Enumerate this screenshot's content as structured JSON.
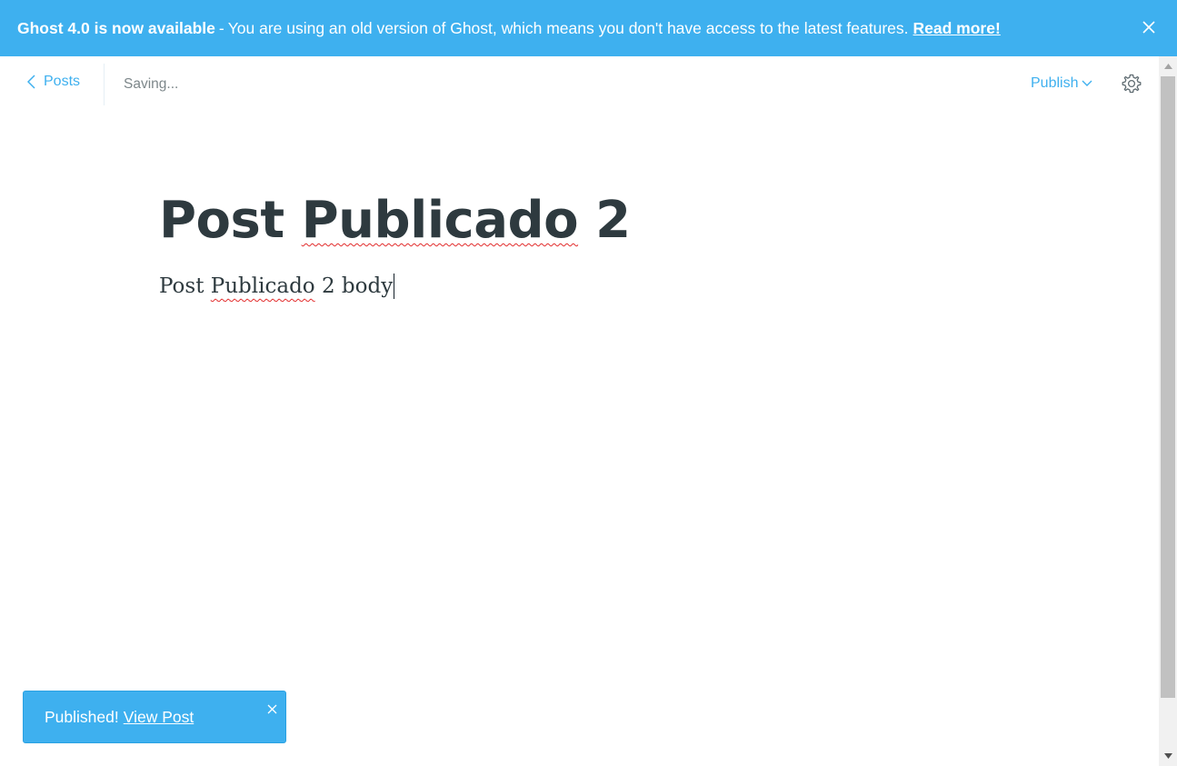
{
  "banner": {
    "strong_text": "Ghost 4.0 is now available",
    "separator": "-",
    "message": "You are using an old version of Ghost, which means you don't have access to the latest features.",
    "link_text": "Read more!",
    "close_icon": "close-icon"
  },
  "toolbar": {
    "back_label": "Posts",
    "back_icon": "chevron-left-icon",
    "status": "Saving...",
    "publish_label": "Publish",
    "publish_icon": "chevron-down-icon",
    "settings_icon": "gear-icon"
  },
  "editor": {
    "title_word1": "Post",
    "title_word2": "Publicado",
    "title_word3": "2",
    "body_word1": "Post",
    "body_word2": "Publicado",
    "body_word3": "2 body"
  },
  "notification": {
    "message": "Published!",
    "link_text": "View Post",
    "close_icon": "close-icon"
  },
  "colors": {
    "accent": "#3eb0ef",
    "text": "#2e3a3f",
    "muted": "#7d878a"
  }
}
